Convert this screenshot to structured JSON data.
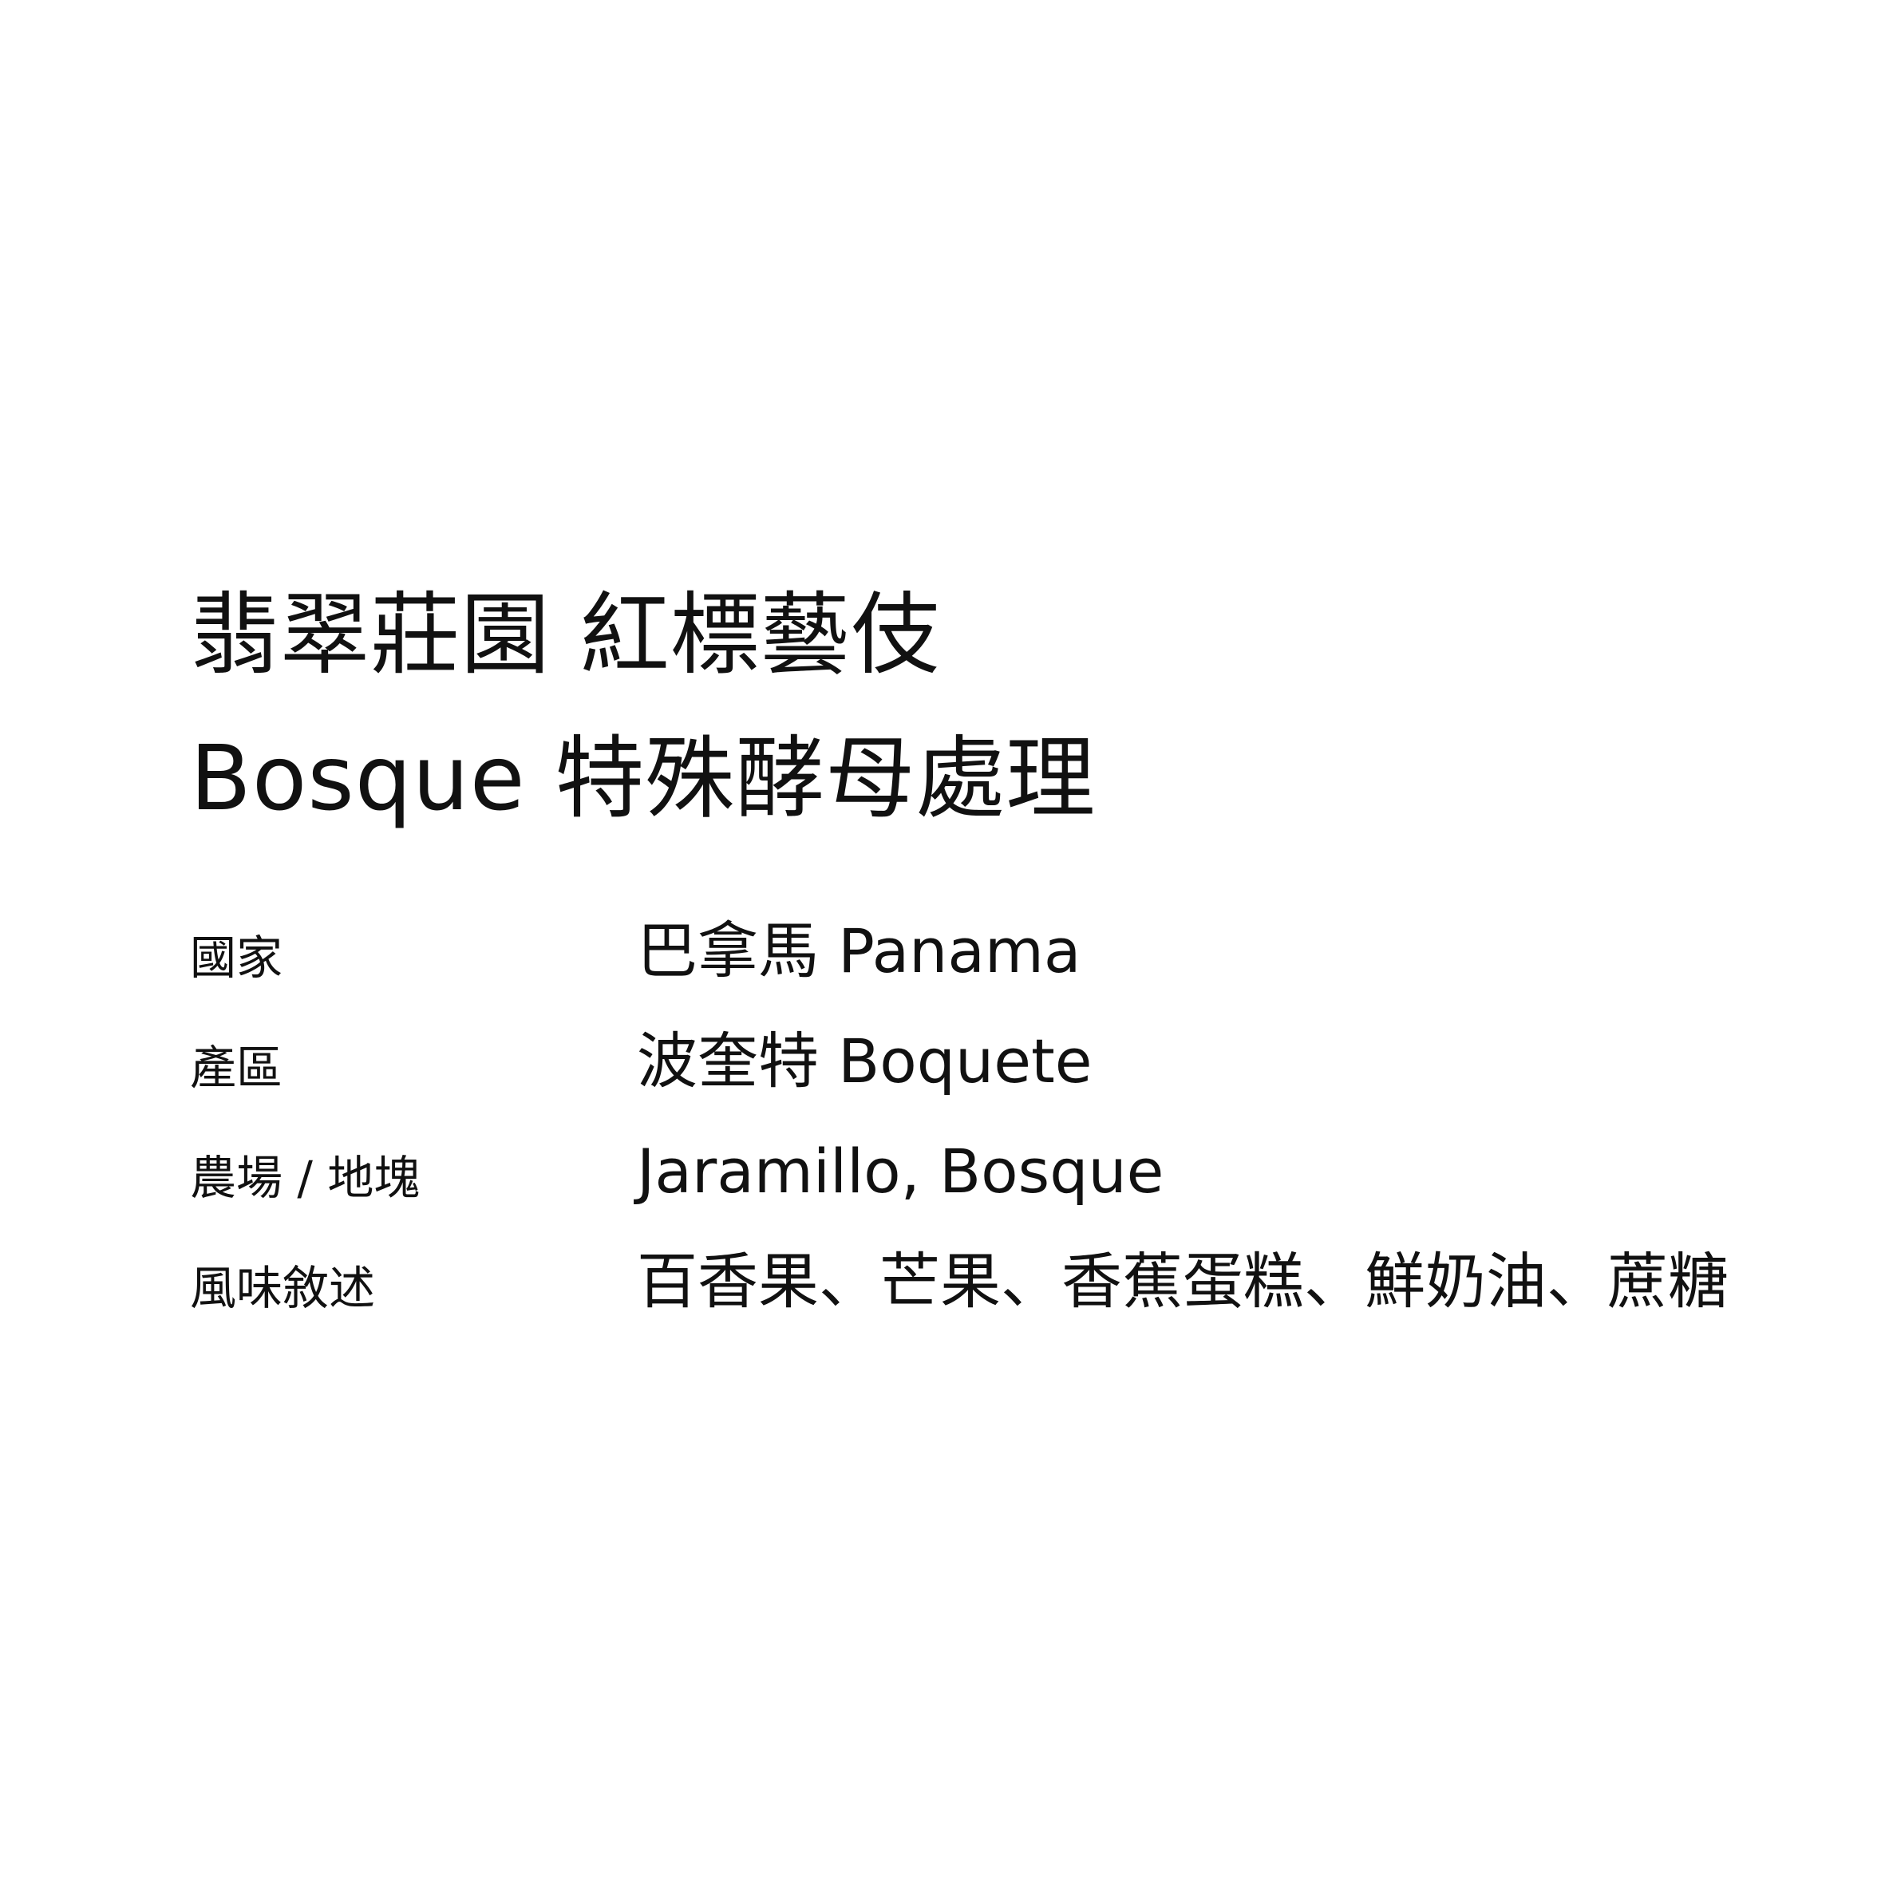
{
  "title": {
    "line1": "翡翠莊園 紅標藝伎",
    "line2": "Bosque 特殊酵母處理"
  },
  "specs": [
    {
      "label": "國家",
      "value": "巴拿馬 Panama"
    },
    {
      "label": "產區",
      "value": "波奎特 Boquete"
    },
    {
      "label": "農場 / 地塊",
      "value": "Jaramillo, Bosque"
    },
    {
      "label": "風味敘述",
      "value": "百香果、芒果、香蕉蛋糕、鮮奶油、蔗糖"
    }
  ]
}
